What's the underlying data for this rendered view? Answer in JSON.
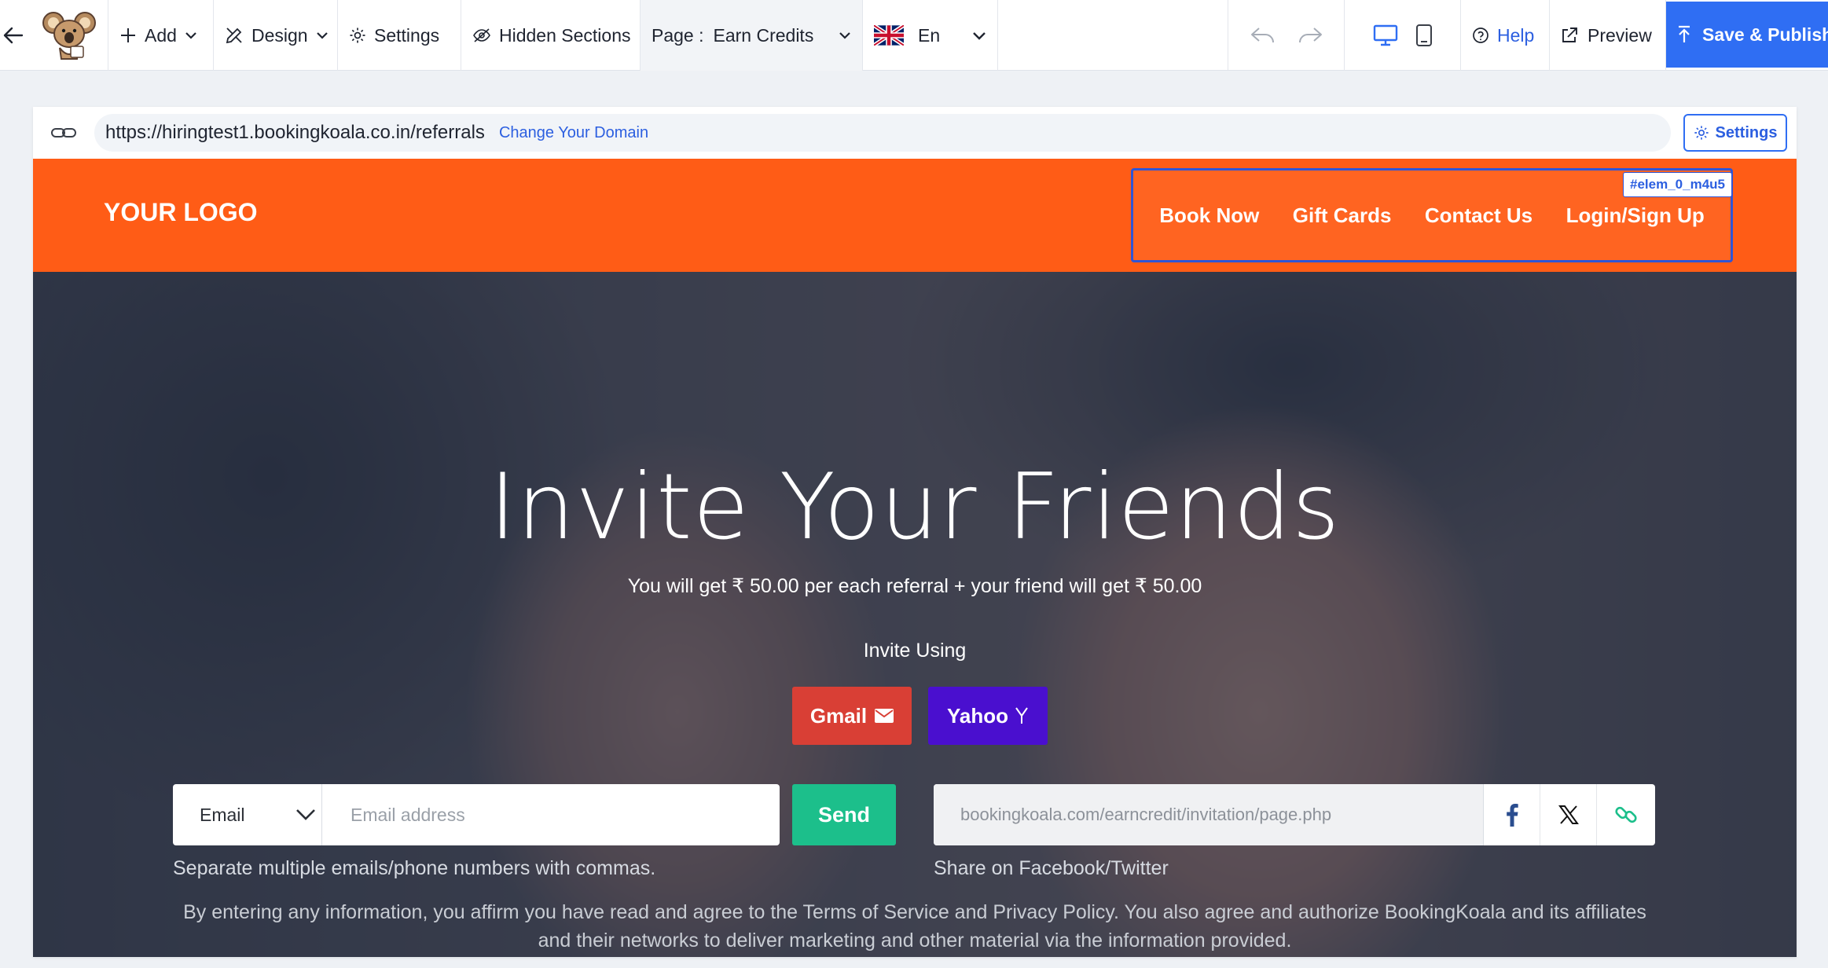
{
  "toolbar": {
    "add_label": "Add",
    "design_label": "Design",
    "settings_label": "Settings",
    "hidden_sections_label": "Hidden Sections",
    "page_prefix": "Page :",
    "page_value": "Earn Credits",
    "language_label": "En",
    "help_label": "Help",
    "preview_label": "Preview",
    "publish_label": "Save & Publish"
  },
  "urlbar": {
    "url": "https://hiringtest1.bookingkoala.co.in/referrals",
    "change_domain": "Change Your Domain",
    "settings_label": "Settings"
  },
  "site": {
    "logo": "YOUR LOGO",
    "nav": [
      "Book Now",
      "Gift Cards",
      "Contact Us",
      "Login/Sign Up"
    ],
    "selected_element_tag": "#elem_0_m4u5"
  },
  "hero": {
    "title": "Invite Your Friends",
    "subtitle": "You will get ₹ 50.00 per each referral + your friend will get ₹ 50.00",
    "invite_using": "Invite Using",
    "gmail_label": "Gmail",
    "yahoo_label": "Yahoo",
    "contact_type": "Email",
    "email_placeholder": "Email address",
    "send_label": "Send",
    "email_help": "Separate multiple emails/phone numbers with commas.",
    "share_link": "bookingkoala.com/earncredit/invitation/page.php",
    "share_help": "Share on Facebook/Twitter",
    "disclaimer": "By entering any information, you affirm you have read and agree to the Terms of Service and Privacy Policy. You also agree and authorize BookingKoala and its affiliates and their networks to deliver marketing and other material via the information provided."
  },
  "icons": [
    "back-arrow-icon",
    "koala-logo-icon",
    "plus-icon",
    "design-tools-icon",
    "gear-icon",
    "eye-slash-icon",
    "chevron-down-icon",
    "uk-flag-icon",
    "undo-icon",
    "redo-icon",
    "desktop-icon",
    "mobile-icon",
    "help-circle-icon",
    "external-link-icon",
    "upload-icon",
    "link-icon",
    "envelope-icon",
    "yahoo-y-icon",
    "facebook-icon",
    "x-twitter-icon",
    "copy-link-icon"
  ],
  "colors": {
    "accent": "#2f6ef3",
    "site_header": "#ff5c16",
    "gmail": "#d93f35",
    "yahoo": "#4a0fcf",
    "send": "#1cbf8b"
  }
}
